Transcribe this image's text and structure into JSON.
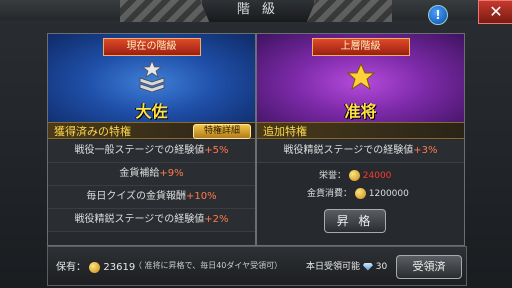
{
  "header": {
    "title": "階 級",
    "info_icon": "info-icon",
    "close_icon": "close-icon"
  },
  "current": {
    "tag": "現在の階級",
    "rank": "大佐",
    "perks_header": "獲得済みの特権",
    "detail_button": "特権詳細",
    "perks": [
      {
        "text": "戦役一般ステージでの経験値",
        "bonus": "+5%"
      },
      {
        "text": "金貨補給",
        "bonus": "+9%"
      },
      {
        "text": "毎日クイズの金貨報酬",
        "bonus": "+10%"
      },
      {
        "text": "戦役精鋭ステージでの経験値",
        "bonus": "+2%"
      }
    ]
  },
  "next": {
    "tag": "上層階級",
    "rank": "准将",
    "perks_header": "追加特権",
    "perks": [
      {
        "text": "戦役精鋭ステージでの経験値",
        "bonus": "+3%"
      }
    ],
    "honor_label": "栄誉：",
    "honor_value": "24000",
    "gold_label": "金貨消費：",
    "gold_value": "1200000",
    "promote_button": "昇 格"
  },
  "footer": {
    "owned_label": "保有：",
    "owned_value": "23619",
    "note": "（ 准将に昇格で、毎日40ダイヤ受領可）",
    "today_label": "本日受領可能",
    "today_value": "30",
    "receive_button": "受領済"
  },
  "colors": {
    "blue_rank": "#1f4fa8",
    "purple_rank": "#7c2aa8",
    "rank_text": "#ffe14a",
    "bonus": "#ff7a4a",
    "honor_red": "#ff3a2a"
  }
}
